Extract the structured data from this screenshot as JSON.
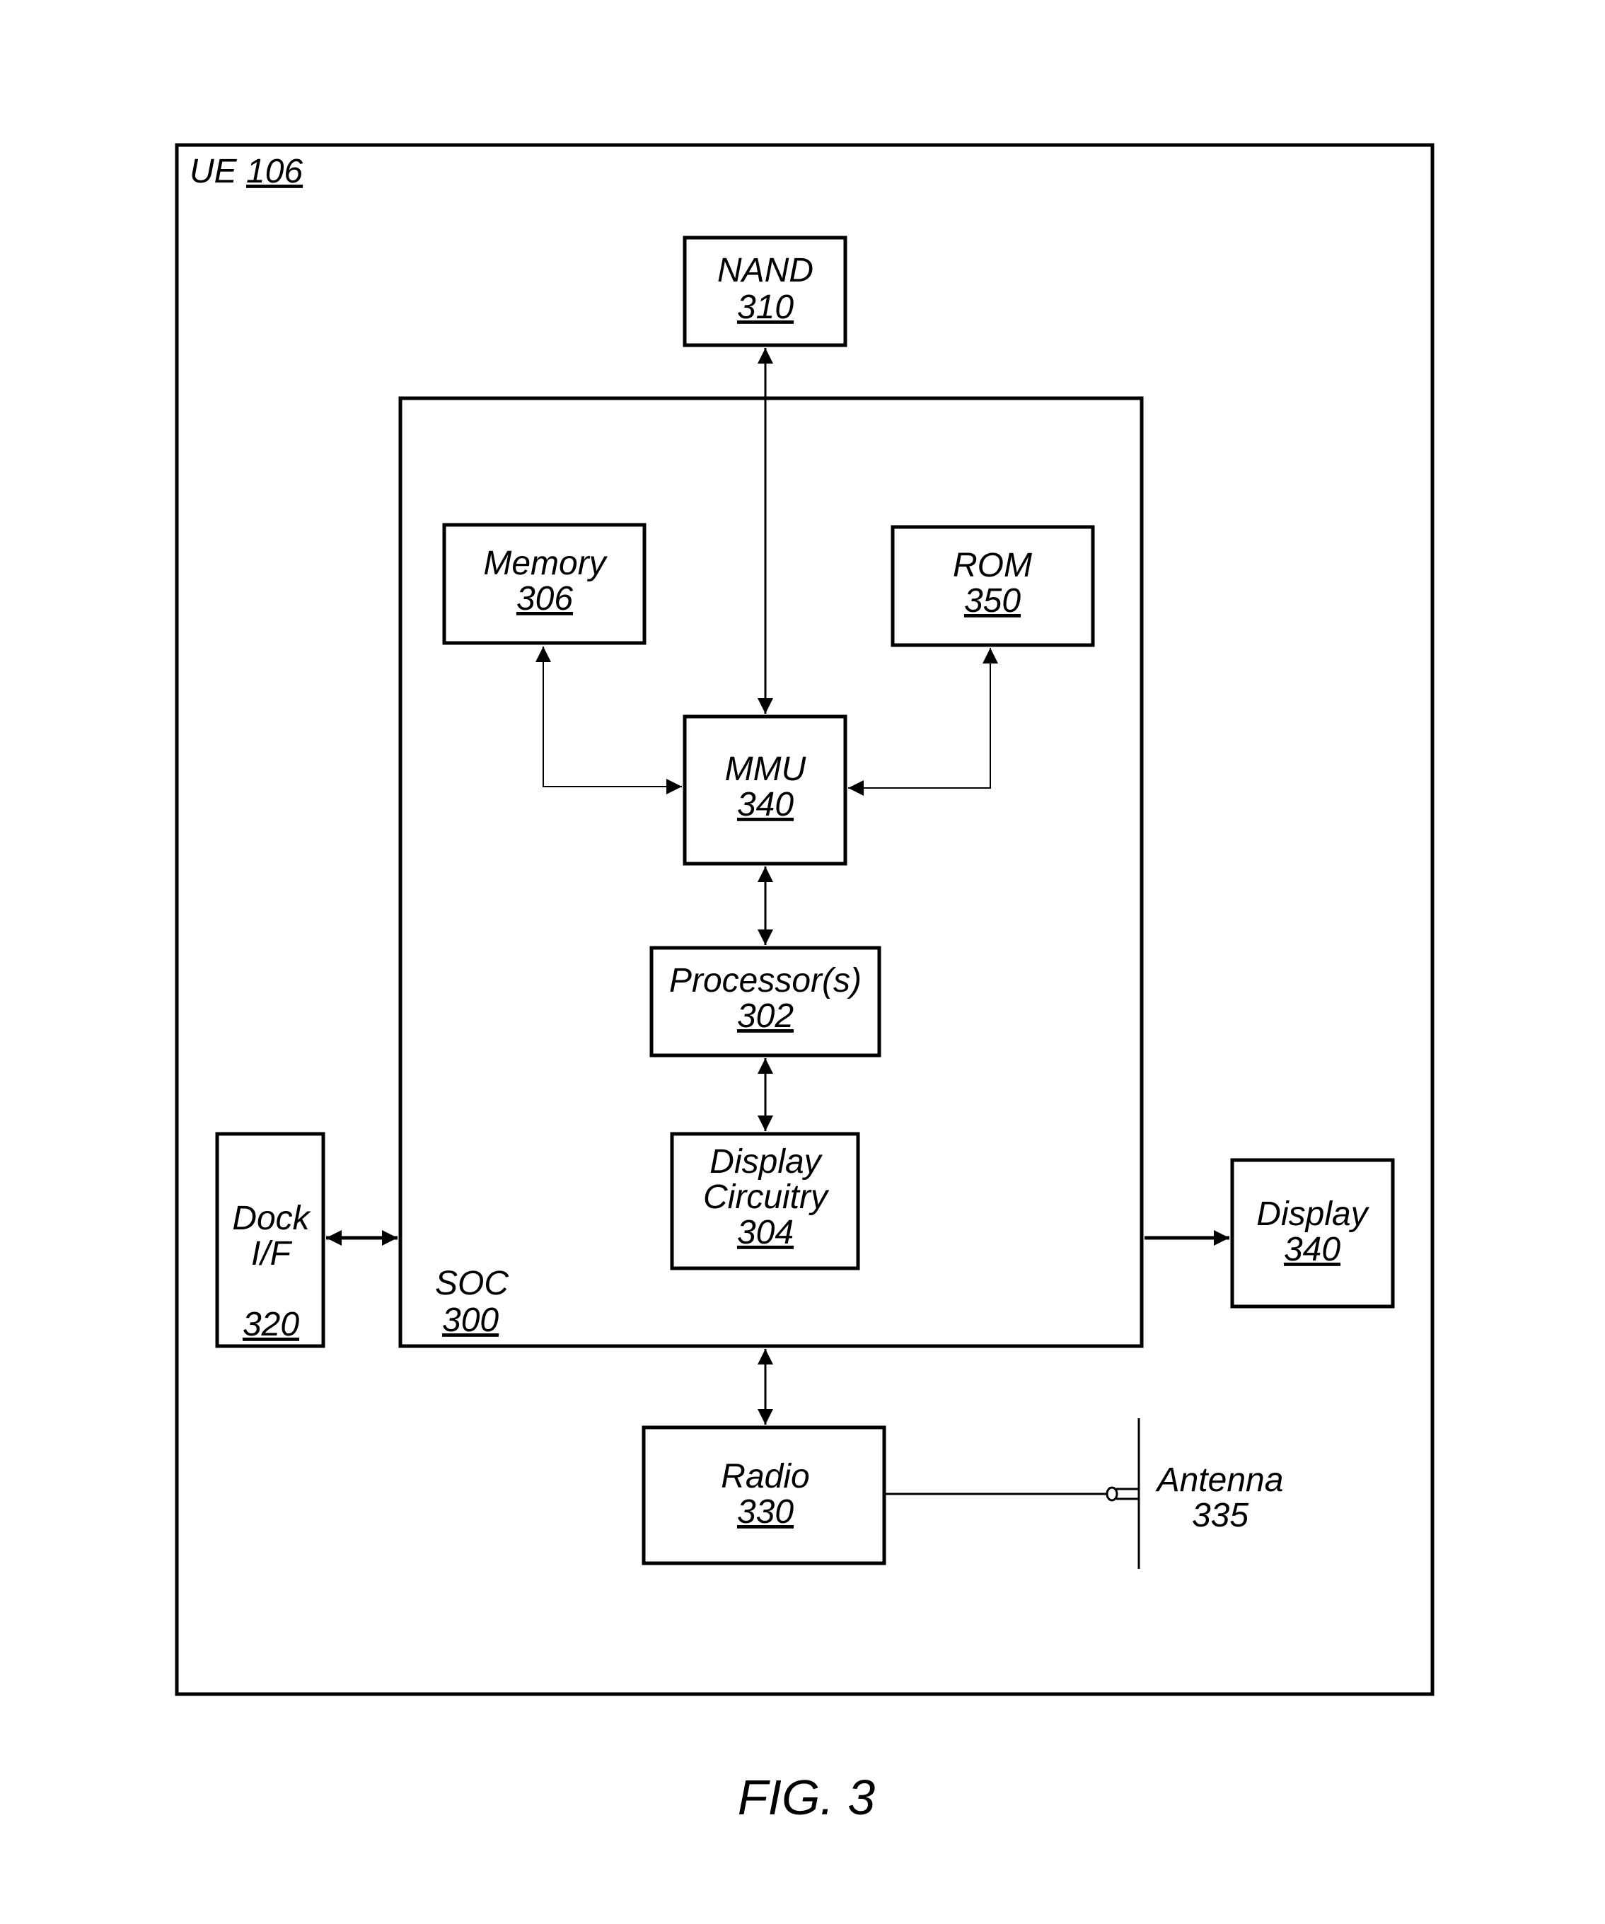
{
  "figure": {
    "label": "FIG. 3",
    "container": {
      "name": "UE",
      "ref": "106"
    }
  },
  "blocks": {
    "nand": {
      "name": "NAND",
      "ref": "310"
    },
    "soc": {
      "name": "SOC",
      "ref": "300"
    },
    "memory": {
      "name": "Memory",
      "ref": "306"
    },
    "rom": {
      "name": "ROM",
      "ref": "350"
    },
    "mmu": {
      "name": "MMU",
      "ref": "340"
    },
    "processor": {
      "name": "Processor(s)",
      "ref": "302"
    },
    "display_circuitry": {
      "name_line1": "Display",
      "name_line2": "Circuitry",
      "ref": "304"
    },
    "dock": {
      "name_line1": "Dock",
      "name_line2": "I/F",
      "ref": "320"
    },
    "display": {
      "name": "Display",
      "ref": "340"
    },
    "radio": {
      "name": "Radio",
      "ref": "330"
    },
    "antenna": {
      "name": "Antenna",
      "ref": "335"
    }
  },
  "connections": [
    {
      "from": "NAND",
      "to": "MMU",
      "type": "bidirectional"
    },
    {
      "from": "Memory",
      "to": "MMU",
      "type": "bidirectional"
    },
    {
      "from": "ROM",
      "to": "MMU",
      "type": "bidirectional"
    },
    {
      "from": "MMU",
      "to": "Processor(s)",
      "type": "bidirectional"
    },
    {
      "from": "Processor(s)",
      "to": "Display Circuitry",
      "type": "bidirectional"
    },
    {
      "from": "Dock I/F",
      "to": "SOC",
      "type": "bidirectional"
    },
    {
      "from": "SOC",
      "to": "Display",
      "type": "unidirectional"
    },
    {
      "from": "SOC",
      "to": "Radio",
      "type": "bidirectional"
    },
    {
      "from": "Radio",
      "to": "Antenna",
      "type": "line"
    }
  ]
}
